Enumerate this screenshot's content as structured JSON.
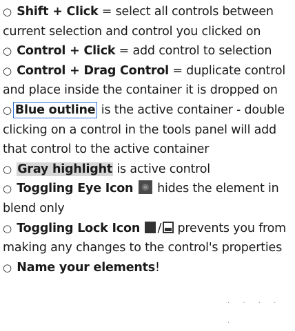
{
  "tips": {
    "shift_click": {
      "key": "Shift + Click",
      "text": " = select all controls between current selection and control you clicked on"
    },
    "control_click": {
      "key": "Control + Click",
      "text": " = add control to selection"
    },
    "control_drag": {
      "key": "Control + Drag Control",
      "text": " = duplicate control and place inside the container it is dropped on"
    },
    "blue_outline": {
      "key": "Blue outline",
      "text": " is the active container - double clicking on a control in the tools panel will add that control to the active container"
    },
    "gray_highlight": {
      "key": "Gray highlight",
      "text": " is active control"
    },
    "eye_icon": {
      "key": "Toggling Eye Icon",
      "text": " hides the element in blend only"
    },
    "lock_icon": {
      "key": "Toggling Lock Icon",
      "separator": "/",
      "text": " prevents you from making any changes to the control's properties"
    },
    "name_elements": {
      "key": "Name your elements",
      "text": "!"
    }
  },
  "bullet": "○",
  "trailing_dots": ". . . . ."
}
